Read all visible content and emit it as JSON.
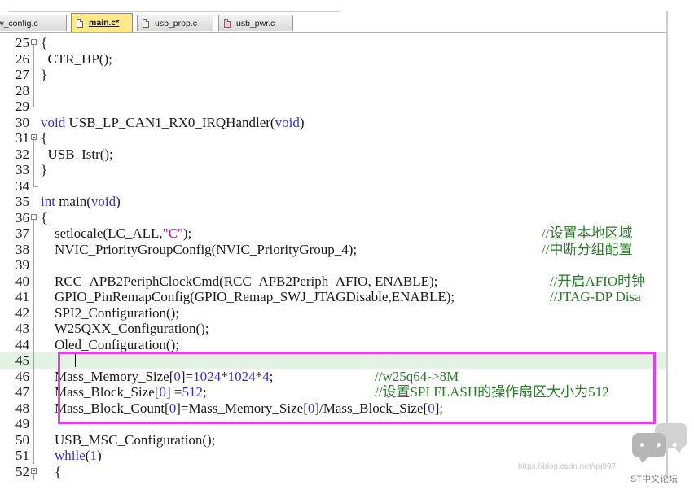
{
  "tabs": [
    {
      "label": "w_config.c",
      "icon": "file-c-icon",
      "active": false
    },
    {
      "label": "main.c*",
      "icon": "file-c-icon",
      "active": true
    },
    {
      "label": "usb_prop.c",
      "icon": "file-c-icon",
      "active": false
    },
    {
      "label": "usb_pwr.c",
      "icon": "file-c-icon",
      "active": false
    }
  ],
  "lines": [
    {
      "num": "25",
      "fold": "box",
      "code": "{"
    },
    {
      "num": "26",
      "fold": "line",
      "code": "  CTR_HP();"
    },
    {
      "num": "27",
      "fold": "line",
      "code": "}"
    },
    {
      "num": "28",
      "fold": "line",
      "code": ""
    },
    {
      "num": "29",
      "fold": "end",
      "code": ""
    },
    {
      "num": "30",
      "fold": "",
      "code": "void USB_LP_CAN1_RX0_IRQHandler(void)"
    },
    {
      "num": "31",
      "fold": "box",
      "code": "{"
    },
    {
      "num": "32",
      "fold": "line",
      "code": "  USB_Istr();"
    },
    {
      "num": "33",
      "fold": "line",
      "code": "}"
    },
    {
      "num": "34",
      "fold": "end",
      "code": ""
    },
    {
      "num": "35",
      "fold": "",
      "code": "int main(void)"
    },
    {
      "num": "36",
      "fold": "box",
      "code": "{"
    },
    {
      "num": "37",
      "fold": "line",
      "code": "    setlocale(LC_ALL,\"C\");",
      "comment": "//设置本地区域"
    },
    {
      "num": "38",
      "fold": "line",
      "code": "    NVIC_PriorityGroupConfig(NVIC_PriorityGroup_4);",
      "comment": "//中断分组配置"
    },
    {
      "num": "39",
      "fold": "line",
      "code": ""
    },
    {
      "num": "40",
      "fold": "line",
      "code": "    RCC_APB2PeriphClockCmd(RCC_APB2Periph_AFIO, ENABLE);",
      "comment": "//开启AFIO时钟"
    },
    {
      "num": "41",
      "fold": "line",
      "code": "    GPIO_PinRemapConfig(GPIO_Remap_SWJ_JTAGDisable,ENABLE);",
      "comment": "//JTAG-DP Disa"
    },
    {
      "num": "42",
      "fold": "line",
      "code": "    SPI2_Configuration();"
    },
    {
      "num": "43",
      "fold": "line",
      "code": "    W25QXX_Configuration();"
    },
    {
      "num": "44",
      "fold": "line",
      "code": "    Oled_Configuration();"
    },
    {
      "num": "45",
      "fold": "line",
      "code": "",
      "highlight": true
    },
    {
      "num": "46",
      "fold": "line",
      "code": "    Mass_Memory_Size[0]=1024*1024*4;",
      "comment": "//w25q64->8M"
    },
    {
      "num": "47",
      "fold": "line",
      "code": "    Mass_Block_Size[0] =512;",
      "comment": "//设置SPI FLASH的操作扇区大小为512"
    },
    {
      "num": "48",
      "fold": "line",
      "code": "    Mass_Block_Count[0]=Mass_Memory_Size[0]/Mass_Block_Size[0];"
    },
    {
      "num": "49",
      "fold": "line",
      "code": ""
    },
    {
      "num": "50",
      "fold": "line",
      "code": "    USB_MSC_Configuration();"
    },
    {
      "num": "51",
      "fold": "line",
      "code": "    while(1)"
    },
    {
      "num": "52",
      "fold": "box",
      "code": "    {"
    }
  ],
  "watermark": "https://blog.csdn.net/qq997",
  "logo_text": "ST中文论坛",
  "colors": {
    "keyword": "#3333cc",
    "string": "#cc00cc",
    "comment": "#3a7a3a",
    "highlight_box": "#e63ee6",
    "current_line": "#e3f3e3",
    "active_tab": "#ffe98a"
  }
}
